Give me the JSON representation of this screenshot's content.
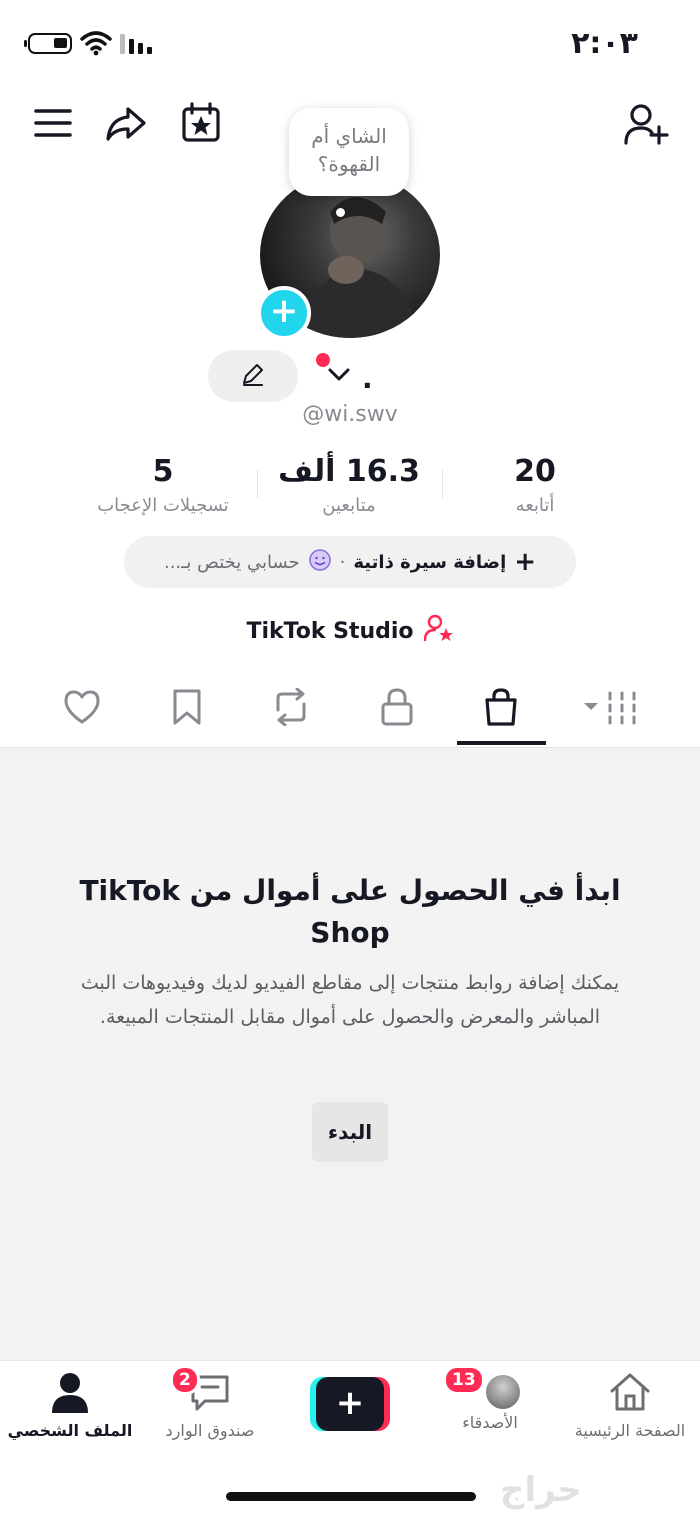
{
  "status_bar": {
    "time": "٢:٠٣"
  },
  "toolbar": {
    "icons": [
      "menu-icon",
      "share-icon",
      "calendar-star-icon",
      "add-friend-icon"
    ]
  },
  "profile": {
    "bubble_note": "الشاي أم القهوة؟",
    "display_name": ".",
    "username": "@wi.swv",
    "stats": [
      {
        "value": "20",
        "label": "أتابعه"
      },
      {
        "value": "16.3 ألف",
        "label": "متابعين"
      },
      {
        "value": "5",
        "label": "تسجيلات الإعجاب"
      }
    ],
    "bio_prompt": {
      "add_label": "إضافة سيرة ذاتية",
      "separator": "·",
      "hint": "حسابي يختص بـ..."
    },
    "studio_label": "TikTok Studio"
  },
  "tabs": {
    "items": [
      "videos-grid",
      "shop",
      "private",
      "reposts",
      "favorites",
      "liked"
    ],
    "active": "shop"
  },
  "empty_state": {
    "title": "ابدأ في الحصول على أموال من TikTok Shop",
    "body": "يمكنك إضافة روابط منتجات إلى مقاطع الفيديو لديك وفيديوهات البث المباشر والمعرض والحصول على أموال مقابل المنتجات المبيعة.",
    "button": "البدء"
  },
  "bottom_nav": {
    "profile": "الملف الشخصي",
    "inbox": "صندوق الوارد",
    "inbox_badge": "2",
    "friends": "الأصدقاء",
    "friends_badge": "13",
    "home": "الصفحة الرئيسية"
  },
  "watermark": "حراج",
  "colors": {
    "accent_red": "#fe2c55",
    "accent_cyan": "#20d5ec",
    "text": "#161823",
    "muted": "#8a8b91"
  }
}
